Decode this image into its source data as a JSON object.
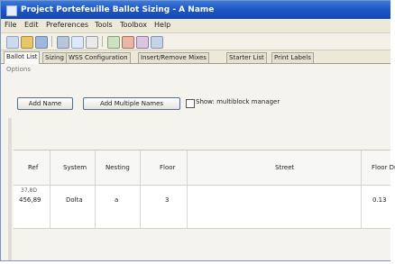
{
  "window": {
    "title": "Project Portefeuille Ballot Sizing - A Name"
  },
  "menu": [
    "File",
    "Edit",
    "Preferences",
    "Tools",
    "Toolbox",
    "Help"
  ],
  "tabs": [
    "Ballot List",
    "Sizing",
    "WSS Configuration",
    "Insert/Remove Mixes",
    "Starter List",
    "Print Labels"
  ],
  "options_label": "Options",
  "buttons": {
    "add_name": "Add Name",
    "add_multiple": "Add Multiple Names"
  },
  "checkbox": {
    "label": "Show: multiblock manager",
    "checked": false
  },
  "table": {
    "headers": [
      "Ref",
      "System",
      "Nesting",
      "Floor",
      "Street",
      "Floor Du"
    ],
    "rows": [
      {
        "ref": "456,89",
        "ref_small": "37,8D",
        "system": "Dolta",
        "nesting": "a",
        "floor": "3",
        "street": "",
        "floor_du": "0.13"
      }
    ]
  },
  "colors": {
    "titlebar": "#1f58c9",
    "window_bg": "#ece9d8"
  }
}
